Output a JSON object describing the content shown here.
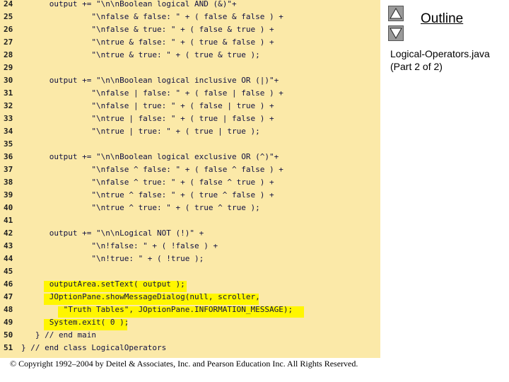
{
  "code_lines": [
    {
      "num": "24",
      "text": "      output += \"\\n\\nBoolean logical AND (&)\"+"
    },
    {
      "num": "25",
      "text": "               \"\\nfalse & false: \" + ( false & false ) +"
    },
    {
      "num": "26",
      "text": "               \"\\nfalse & true: \" + ( false & true ) +"
    },
    {
      "num": "27",
      "text": "               \"\\ntrue & false: \" + ( true & false ) +"
    },
    {
      "num": "28",
      "text": "               \"\\ntrue & true: \" + ( true & true );"
    },
    {
      "num": "29",
      "text": ""
    },
    {
      "num": "30",
      "text": "      output += \"\\n\\nBoolean logical inclusive OR (|)\"+"
    },
    {
      "num": "31",
      "text": "               \"\\nfalse | false: \" + ( false | false ) +"
    },
    {
      "num": "32",
      "text": "               \"\\nfalse | true: \" + ( false | true ) +"
    },
    {
      "num": "33",
      "text": "               \"\\ntrue | false: \" + ( true | false ) +"
    },
    {
      "num": "34",
      "text": "               \"\\ntrue | true: \" + ( true | true );"
    },
    {
      "num": "35",
      "text": ""
    },
    {
      "num": "36",
      "text": "      output += \"\\n\\nBoolean logical exclusive OR (^)\"+"
    },
    {
      "num": "37",
      "text": "               \"\\nfalse ^ false: \" + ( false ^ false ) +"
    },
    {
      "num": "38",
      "text": "               \"\\nfalse ^ true: \" + ( false ^ true ) +"
    },
    {
      "num": "39",
      "text": "               \"\\ntrue ^ false: \" + ( true ^ false ) +"
    },
    {
      "num": "40",
      "text": "               \"\\ntrue ^ true: \" + ( true ^ true );"
    },
    {
      "num": "41",
      "text": ""
    },
    {
      "num": "42",
      "text": "      output += \"\\n\\nLogical NOT (!)\" +"
    },
    {
      "num": "43",
      "text": "               \"\\n!false: \" + ( !false ) +"
    },
    {
      "num": "44",
      "text": "               \"\\n!true: \" + ( !true );"
    },
    {
      "num": "45",
      "text": ""
    },
    {
      "num": "46",
      "text": "      outputArea.setText( output );"
    },
    {
      "num": "47",
      "text": "      JOptionPane.showMessageDialog(null, scroller,"
    },
    {
      "num": "48",
      "text": "         \"Truth Tables\", JOptionPane.INFORMATION_MESSAGE);"
    },
    {
      "num": "49",
      "text": "      System.exit( 0 );"
    },
    {
      "num": "50",
      "text": "   } // end main"
    },
    {
      "num": "51",
      "text": "} // end class LogicalOperators"
    }
  ],
  "sidebar": {
    "outline_label": "Outline",
    "up_icon": "triangle-up-icon",
    "down_icon": "triangle-down-icon",
    "file_note": "Logical-Operators.java (Part 2 of 2)"
  },
  "footer": "© Copyright 1992–2004 by Deitel & Associates, Inc. and Pearson Education Inc. All Rights Reserved.",
  "colors": {
    "code_background": "#fbe9a8",
    "highlight": "#fff600",
    "nav_button": "#9a9a9a"
  }
}
